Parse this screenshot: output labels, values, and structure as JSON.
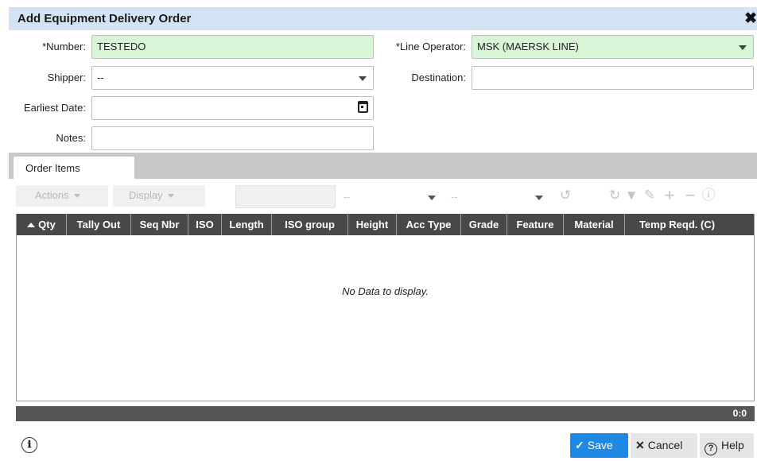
{
  "dialog": {
    "title": "Add Equipment Delivery Order",
    "close_icon": "✖"
  },
  "form": {
    "number_label": "*Number:",
    "number_value": "TESTEDO",
    "line_operator_label": "*Line Operator:",
    "line_operator_value": "MSK (MAERSK LINE)",
    "shipper_label": "Shipper:",
    "shipper_value": "--",
    "destination_label": "Destination:",
    "destination_value": "",
    "earliest_date_label": "Earliest Date:",
    "earliest_date_value": "",
    "notes_label": "Notes:",
    "notes_value": ""
  },
  "tabs": [
    {
      "label": "Order Items",
      "active": true
    }
  ],
  "toolbar": {
    "actions_label": "Actions",
    "display_label": "Display",
    "filter_select1": "--",
    "filter_select2": "--",
    "icons": [
      "history-icon",
      "refresh-icon",
      "filter-icon",
      "edit-icon",
      "add-icon",
      "remove-icon",
      "help-icon"
    ]
  },
  "grid": {
    "columns": [
      "Qty",
      "Tally Out",
      "Seq Nbr",
      "ISO",
      "Length",
      "ISO group",
      "Height",
      "Acc Type",
      "Grade",
      "Feature",
      "Material",
      "Temp Reqd. (C)"
    ],
    "sorted_column": "Qty",
    "sort_direction": "ascending",
    "rows": [],
    "empty_message": "No Data to display.",
    "count": "0:0"
  },
  "footer": {
    "save_label": "Save",
    "cancel_label": "Cancel",
    "help_label": "Help",
    "info_icon": "ℹ"
  },
  "colors": {
    "title_bar": "#d4e3f3",
    "required_field": "#d8f5d8",
    "grid_header": "#484848",
    "save_button": "#1e88e5"
  }
}
